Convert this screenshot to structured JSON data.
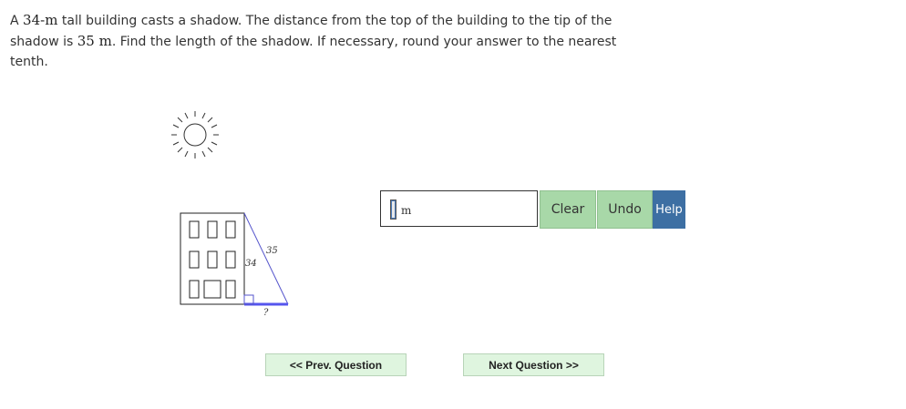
{
  "question": {
    "part1": "A ",
    "height_value": "34",
    "height_unit": "-m",
    "part2": " tall building casts a shadow. The distance from the top of the building to the tip of the shadow is ",
    "hyp_value": "35",
    "hyp_unit": " m",
    "part3": ". Find the length of the shadow. If necessary, round your answer to the nearest tenth."
  },
  "figure": {
    "side_label": "34",
    "hyp_label": "35",
    "shadow_label": "?",
    "colors": {
      "building": "#222222",
      "hypotenuse": "#5555cc",
      "shadow": "#5555ee"
    }
  },
  "answer": {
    "value": "",
    "unit": "m"
  },
  "buttons": {
    "clear": "Clear",
    "undo": "Undo",
    "help": "Help",
    "prev": "<< Prev. Question",
    "next": "Next Question >>"
  },
  "colors": {
    "action_button": "#a8d8a8",
    "help_button": "#3d6fa3",
    "nav_button": "#dff5df"
  }
}
